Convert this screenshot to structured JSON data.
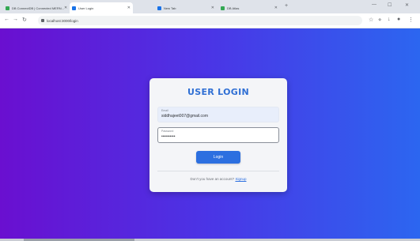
{
  "browser": {
    "tabs": [
      {
        "title": "DB ConnectDB | Connected MERN...",
        "color": "#34a853",
        "active": false
      },
      {
        "title": "User Login",
        "color": "#1a73e8",
        "active": true
      },
      {
        "title": "New Tab",
        "color": "#1a73e8",
        "active": false
      },
      {
        "title": "DB Atlas",
        "color": "#34a853",
        "active": false
      }
    ],
    "address": "localhost:3000/login"
  },
  "login": {
    "title": "USER LOGIN",
    "email_label": "Email",
    "email_value": "siddhajeet007@gmail.com",
    "password_label": "Password",
    "password_value": "••••••••••",
    "button_label": "Login",
    "signup_prompt": "Don't you have an account?",
    "signup_link": "Signup"
  }
}
